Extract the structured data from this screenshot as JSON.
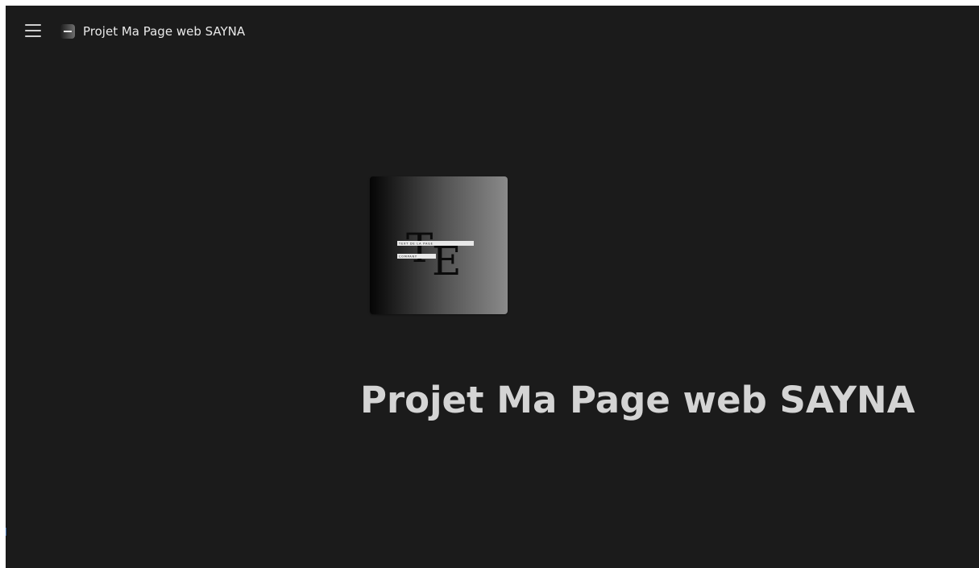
{
  "window": {
    "title": "Projet Ma Page web SAYNA"
  },
  "header": {
    "menu_icon": "hamburger-icon",
    "favicon_icon": "site-logo-icon",
    "title": "Projet Ma Page web SAYNA"
  },
  "hero": {
    "logo_icon": "site-logo",
    "logo_monogram": "TE",
    "logo_caption_top": "TEXT DE LA PAGE",
    "logo_caption_bottom": "COMPANY",
    "title": "Projet Ma Page web SAYNA"
  },
  "colors": {
    "background": "#1b1b1b",
    "text_primary": "#e9e9e9",
    "hero_text": "#d4d4d4"
  }
}
